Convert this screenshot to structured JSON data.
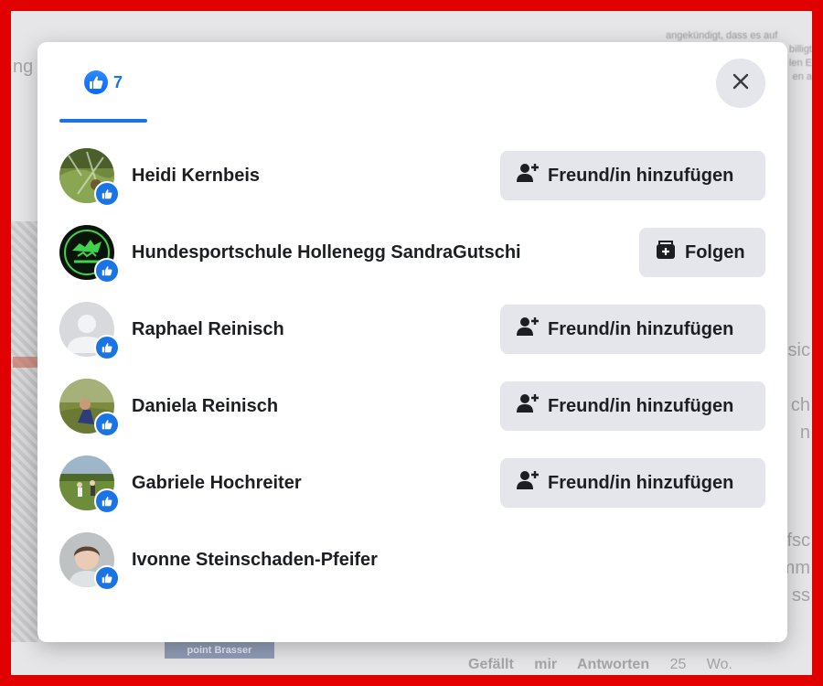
{
  "background": {
    "left_word": "ng",
    "right_text_lines": [
      "angekündigt, dass es auf",
      "billigt",
      "len E",
      "en a"
    ],
    "right_words": [
      "sic",
      "ch",
      "n",
      "fsc",
      "mm",
      "ss"
    ],
    "bottom_actions": [
      "Gefällt mir",
      "Antworten",
      "25 Wo."
    ],
    "ad_badge": "point Brasser"
  },
  "dialog": {
    "tabs": [
      {
        "id": "all",
        "reaction": "like-icon",
        "count": "7",
        "active": true
      }
    ],
    "close_icon": "close-icon",
    "people": [
      {
        "name": "Heidi Kernbeis",
        "avatar": "photo-green-garden",
        "action": "add",
        "action_label": "Freund/in hinzufügen",
        "action_icon": "add-friend-icon"
      },
      {
        "name": "Hundesportschule Hollenegg SandraGutschi",
        "avatar": "logo-dog-school",
        "action": "follow",
        "action_label": "Folgen",
        "action_icon": "follow-page-icon"
      },
      {
        "name": "Raphael Reinisch",
        "avatar": "default-silhouette",
        "action": "add",
        "action_label": "Freund/in hinzufügen",
        "action_icon": "add-friend-icon"
      },
      {
        "name": "Daniela Reinisch",
        "avatar": "photo-person-outdoors",
        "action": "add",
        "action_label": "Freund/in hinzufügen",
        "action_icon": "add-friend-icon"
      },
      {
        "name": "Gabriele Hochreiter",
        "avatar": "photo-field-group",
        "action": "add",
        "action_label": "Freund/in hinzufügen",
        "action_icon": "add-friend-icon"
      },
      {
        "name": "Ivonne Steinschaden-Pfeifer",
        "avatar": "photo-portrait",
        "action": "none",
        "action_label": "",
        "action_icon": ""
      }
    ]
  },
  "colors": {
    "accent": "#1b74e4",
    "frame": "#e10000",
    "button_bg": "#e4e6eb"
  }
}
